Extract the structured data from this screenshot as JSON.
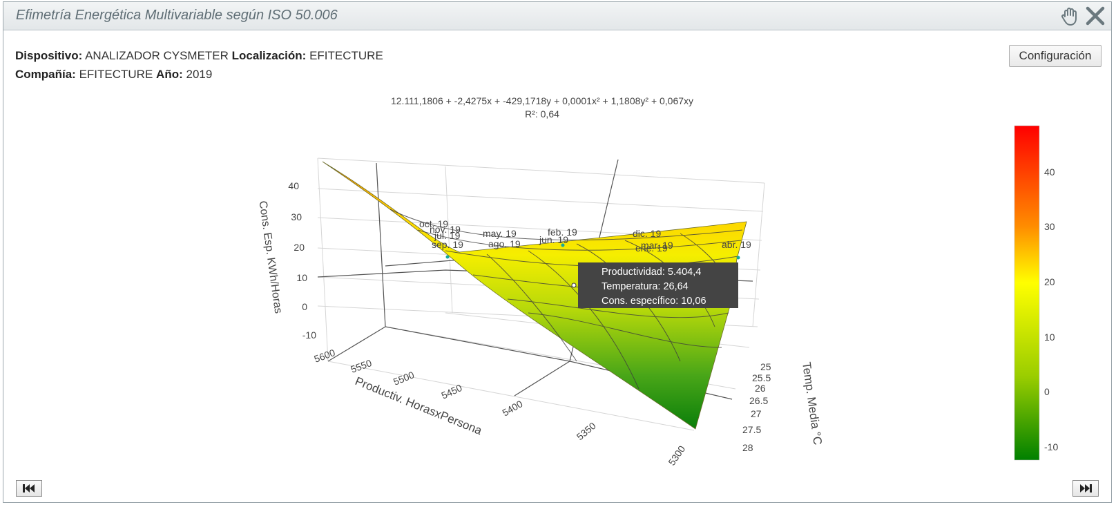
{
  "window": {
    "title": "Efimetría Energética Multivariable según ISO 50.006",
    "icons": [
      "hand-icon",
      "close-icon"
    ]
  },
  "info": {
    "dispositivo_label": "Dispositivo:",
    "dispositivo_value": "ANALIZADOR CYSMETER",
    "localizacion_label": "Localización:",
    "localizacion_value": "EFITECTURE",
    "compania_label": "Compañía:",
    "compania_value": "EFITECTURE",
    "anio_label": "Año:",
    "anio_value": "2019"
  },
  "toolbar": {
    "config_label": "Configuración"
  },
  "footer": {
    "first_icon": "skip-first-icon",
    "last_icon": "skip-last-icon"
  },
  "chart_data": {
    "type": "surface3d",
    "equation": "12.111,1806 + -2,4275x + -429,1718y + 0,0001x² + 1,1808y² + 0,067xy",
    "r2": "R²: 0,64",
    "axes": {
      "z": {
        "label": "Cons. Esp. KWh/Horas",
        "ticks": [
          "40",
          "30",
          "20",
          "10",
          "0",
          "-10"
        ]
      },
      "x": {
        "label": "Productiv. HorasxPersona",
        "ticks": [
          "5600",
          "5550",
          "5500",
          "5450",
          "5400",
          "5350",
          "5300"
        ]
      },
      "y": {
        "label": "Temp. Media °C",
        "ticks": [
          "25",
          "25.5",
          "26",
          "26.5",
          "27",
          "27.5",
          "28"
        ]
      }
    },
    "points": [
      {
        "label": "oct. 19"
      },
      {
        "label": "nov. 19"
      },
      {
        "label": "jul. 19"
      },
      {
        "label": "sep. 19"
      },
      {
        "label": "may. 19"
      },
      {
        "label": "ago. 19"
      },
      {
        "label": "feb. 19"
      },
      {
        "label": "jun. 19"
      },
      {
        "label": "dic. 19"
      },
      {
        "label": "mar. 19"
      },
      {
        "label": "ene. 19"
      },
      {
        "label": "abr. 19"
      }
    ],
    "tooltip": {
      "line1": "Productividad: 5.404,4",
      "line2": "Temperatura: 26,64",
      "line3": "Cons. específico: 10,06"
    },
    "colorbar": {
      "ticks": [
        "40",
        "30",
        "20",
        "10",
        "0",
        "-10"
      ],
      "colors": [
        "#ff0000",
        "#ff8c00",
        "#ffff00",
        "#9acd00",
        "#008000"
      ]
    }
  }
}
